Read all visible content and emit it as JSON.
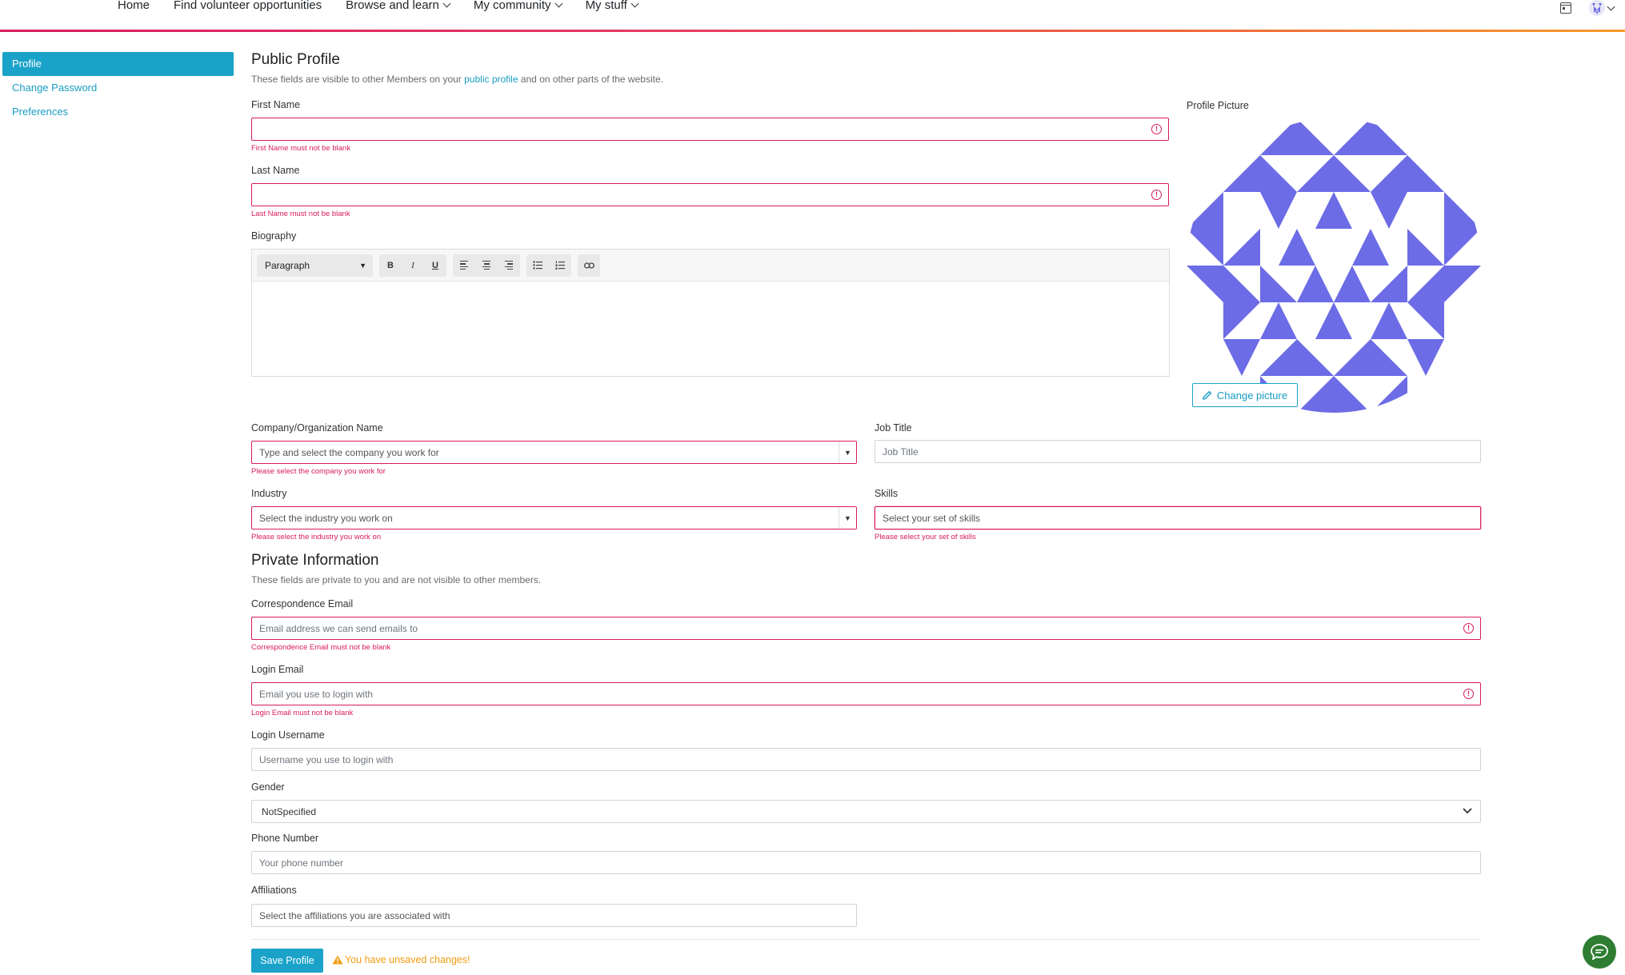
{
  "nav": {
    "items": [
      {
        "label": "Home",
        "dropdown": false
      },
      {
        "label": "Find volunteer opportunities",
        "dropdown": false
      },
      {
        "label": "Browse and learn",
        "dropdown": true
      },
      {
        "label": "My community",
        "dropdown": true
      },
      {
        "label": "My stuff",
        "dropdown": true
      }
    ],
    "accent_gradient": [
      "#d81b60",
      "#f89b2c"
    ]
  },
  "sidebar": {
    "items": [
      {
        "label": "Profile",
        "active": true
      },
      {
        "label": "Change Password",
        "active": false
      },
      {
        "label": "Preferences",
        "active": false
      }
    ]
  },
  "public_profile": {
    "title": "Public Profile",
    "subtitle_before": "These fields are visible to other Members on your ",
    "subtitle_link": "public profile",
    "subtitle_after": " and on other parts of the website.",
    "first_name": {
      "label": "First Name",
      "value": "",
      "error": "First Name must not be blank"
    },
    "last_name": {
      "label": "Last Name",
      "value": "",
      "error": "Last Name must not be blank"
    },
    "biography": {
      "label": "Biography",
      "format_select": "Paragraph",
      "tools": [
        "B",
        "I",
        "U"
      ]
    },
    "profile_picture": {
      "label": "Profile Picture",
      "change_button": "Change picture"
    },
    "company": {
      "label": "Company/Organization Name",
      "placeholder": "Type and select the company you work for",
      "error": "Please select the company you work for"
    },
    "job_title": {
      "label": "Job Title",
      "placeholder": "Job Title"
    },
    "industry": {
      "label": "Industry",
      "placeholder": "Select the industry you work on",
      "error": "Please select the industry you work on"
    },
    "skills": {
      "label": "Skills",
      "placeholder": "Select your set of skills",
      "error": "Please select your set of skills"
    }
  },
  "private_info": {
    "title": "Private Information",
    "subtitle": "These fields are private to you and are not visible to other members.",
    "correspondence_email": {
      "label": "Correspondence Email",
      "placeholder": "Email address we can send emails to",
      "error": "Correspondence Email must not be blank"
    },
    "login_email": {
      "label": "Login Email",
      "placeholder": "Email you use to login with",
      "error": "Login Email must not be blank"
    },
    "login_username": {
      "label": "Login Username",
      "placeholder": "Username you use to login with"
    },
    "gender": {
      "label": "Gender",
      "value": "NotSpecified"
    },
    "phone": {
      "label": "Phone Number",
      "placeholder": "Your phone number"
    },
    "affiliations": {
      "label": "Affiliations",
      "placeholder": "Select the affiliations you are associated with"
    }
  },
  "footer": {
    "save_button": "Save Profile",
    "unsaved_message": "You have unsaved changes!"
  },
  "colors": {
    "primary": "#1aa2c9",
    "error": "#d81b60",
    "warning": "#f39c12",
    "identicon": "#6c6ce6"
  }
}
